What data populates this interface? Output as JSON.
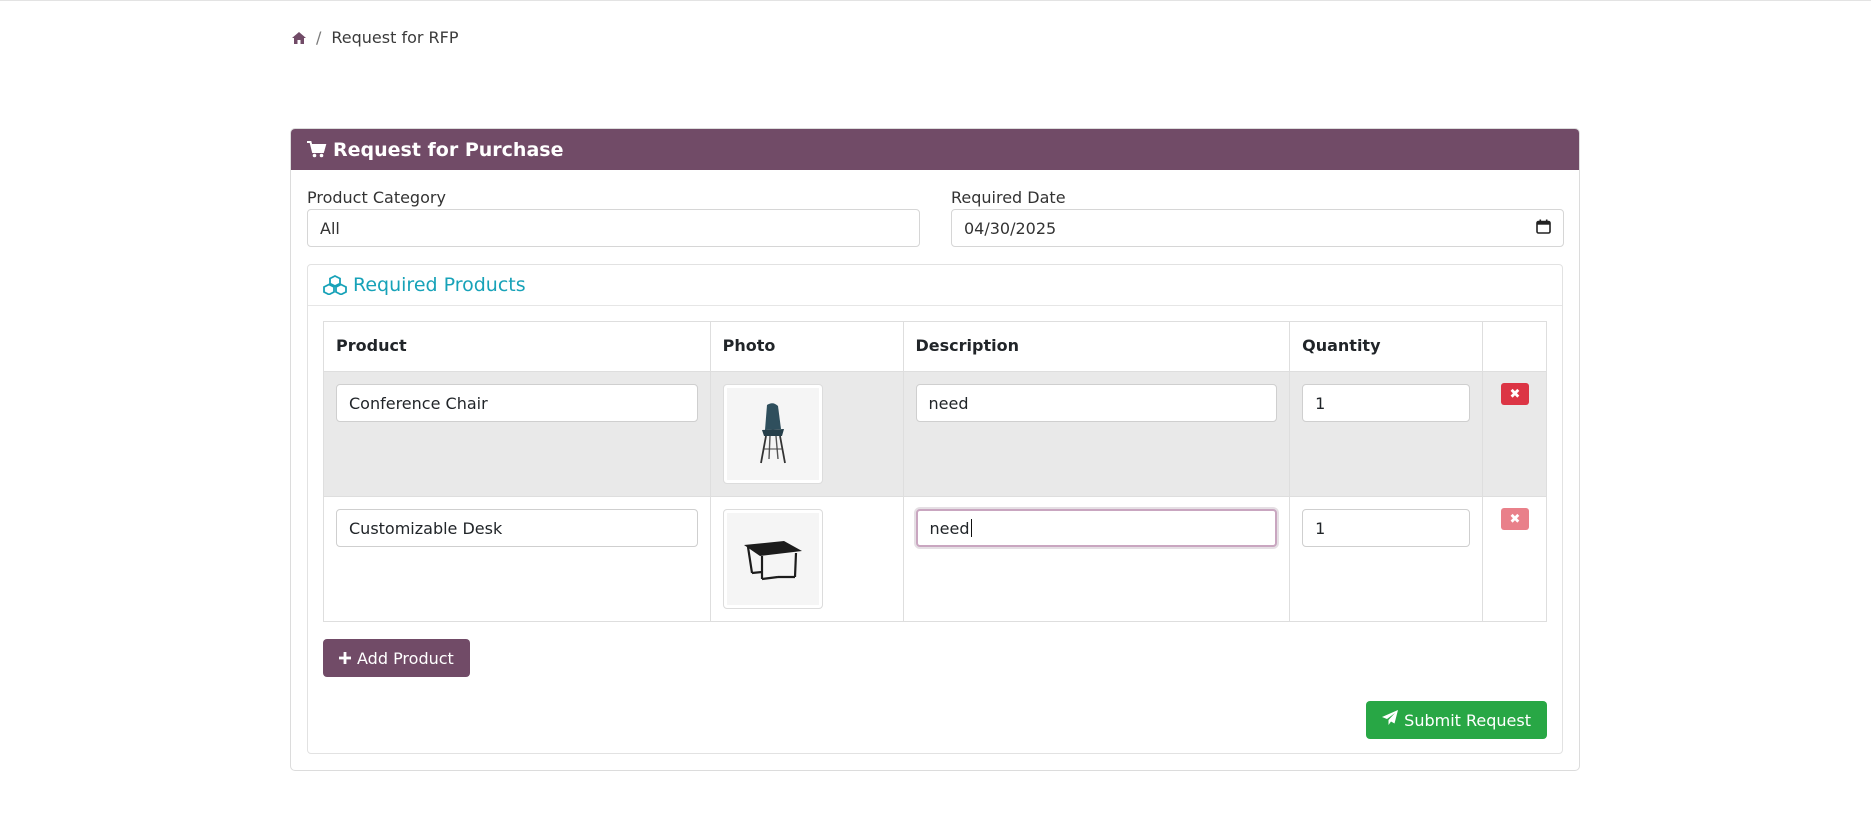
{
  "breadcrumb": {
    "current": "Request for RFP",
    "separator": "/"
  },
  "card": {
    "title": "Request for Purchase"
  },
  "form": {
    "category_label": "Product Category",
    "category_value": "All",
    "date_label": "Required Date",
    "date_value": "04/30/2025"
  },
  "products_section": {
    "title": "Required Products",
    "columns": [
      "Product",
      "Photo",
      "Description",
      "Quantity",
      ""
    ],
    "rows": [
      {
        "product": "Conference Chair",
        "photo_icon": "chair-photo",
        "description": "need",
        "quantity": "1"
      },
      {
        "product": "Customizable Desk",
        "photo_icon": "desk-photo",
        "description": "need",
        "quantity": "1"
      }
    ],
    "delete_symbol": "✖"
  },
  "buttons": {
    "add_product": "Add Product",
    "submit": "Submit Request"
  },
  "colors": {
    "brand": "#714b67",
    "accent": "#17a2b8",
    "danger": "#dc3545",
    "success": "#28a745"
  }
}
